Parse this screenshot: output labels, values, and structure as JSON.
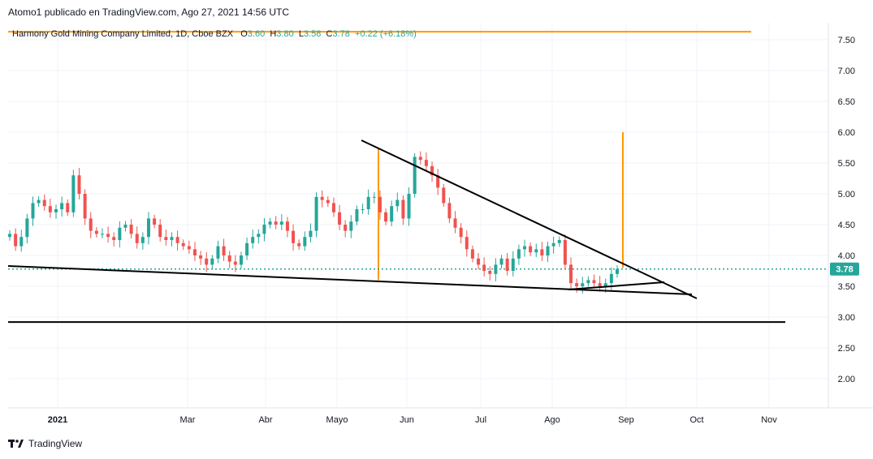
{
  "header": {
    "publisher": "Atomo1 publicado en TradingView.com, Ago 27, 2021 14:56 UTC"
  },
  "legend": {
    "symbol": "Harmony Gold Mining Company Limited, 1D, Cboe BZX",
    "o_label": "O",
    "o_value": "3.60",
    "h_label": "H",
    "h_value": "3.80",
    "l_label": "L",
    "l_value": "3.58",
    "c_label": "C",
    "c_value": "3.78",
    "change": "+0.22 (+6.18%)"
  },
  "footer": {
    "brand": "TradingView"
  },
  "chart_data": {
    "type": "candlestick",
    "y_ticks": [
      "7.50",
      "7.00",
      "6.50",
      "6.00",
      "5.50",
      "5.00",
      "4.50",
      "4.00",
      "3.50",
      "3.00",
      "2.50",
      "2.00"
    ],
    "x_ticks": [
      "2021",
      "Mar",
      "Abr",
      "Mayo",
      "Jun",
      "Jul",
      "Ago",
      "Sep",
      "Oct",
      "Nov"
    ],
    "ylim": [
      1.55,
      7.9
    ],
    "last_price": "3.78",
    "colors": {
      "up": "#26a69a",
      "down": "#ef5350",
      "annotation": "#ff9800",
      "trendline": "#000000",
      "price_line": "#26a69a"
    },
    "candles_close_series": [
      4.35,
      4.15,
      4.3,
      4.6,
      4.85,
      4.9,
      4.8,
      4.7,
      4.75,
      4.85,
      4.7,
      5.3,
      5.0,
      4.6,
      4.4,
      4.35,
      4.35,
      4.3,
      4.25,
      4.45,
      4.5,
      4.35,
      4.2,
      4.3,
      4.6,
      4.5,
      4.3,
      4.25,
      4.3,
      4.2,
      4.15,
      4.1,
      4.0,
      3.95,
      3.85,
      3.95,
      4.15,
      4.0,
      3.9,
      3.85,
      4.0,
      4.2,
      4.3,
      4.35,
      4.5,
      4.55,
      4.5,
      4.55,
      4.4,
      4.2,
      4.15,
      4.3,
      4.4,
      4.95,
      4.9,
      4.85,
      4.7,
      4.5,
      4.4,
      4.55,
      4.75,
      4.75,
      4.95,
      4.95,
      4.7,
      4.55,
      4.8,
      4.9,
      4.6,
      5.0,
      5.6,
      5.55,
      5.45,
      5.3,
      5.1,
      4.85,
      4.6,
      4.45,
      4.3,
      4.1,
      3.95,
      3.85,
      3.75,
      3.7,
      3.85,
      3.95,
      3.75,
      3.95,
      4.1,
      4.15,
      4.05,
      4.1,
      4.0,
      4.15,
      4.2,
      4.25,
      3.85,
      3.55,
      3.5,
      3.55,
      3.6,
      3.55,
      3.5,
      3.55,
      3.7,
      3.78
    ],
    "annotations": [
      {
        "kind": "horizontal",
        "color": "orange",
        "y": 7.63,
        "x_from": "Jan 2021",
        "x_to": "late Oct"
      },
      {
        "kind": "horizontal",
        "color": "black",
        "y": 2.92,
        "x_from": "Jan 2021",
        "x_to": "late Oct"
      },
      {
        "kind": "vertical",
        "color": "orange",
        "y_from": 3.6,
        "y_to": 5.75,
        "at": "mid May"
      },
      {
        "kind": "vertical",
        "color": "orange",
        "y_from": 3.8,
        "y_to": 6.0,
        "at": "end Aug"
      },
      {
        "kind": "trendline",
        "color": "black",
        "points": [
          [
            4.87,
            5.88
          ],
          [
            0.9,
            3.3
          ]
        ]
      },
      {
        "kind": "trendline",
        "color": "black",
        "points": [
          [
            0,
            3.85
          ],
          [
            1.0,
            3.4
          ]
        ]
      }
    ]
  }
}
